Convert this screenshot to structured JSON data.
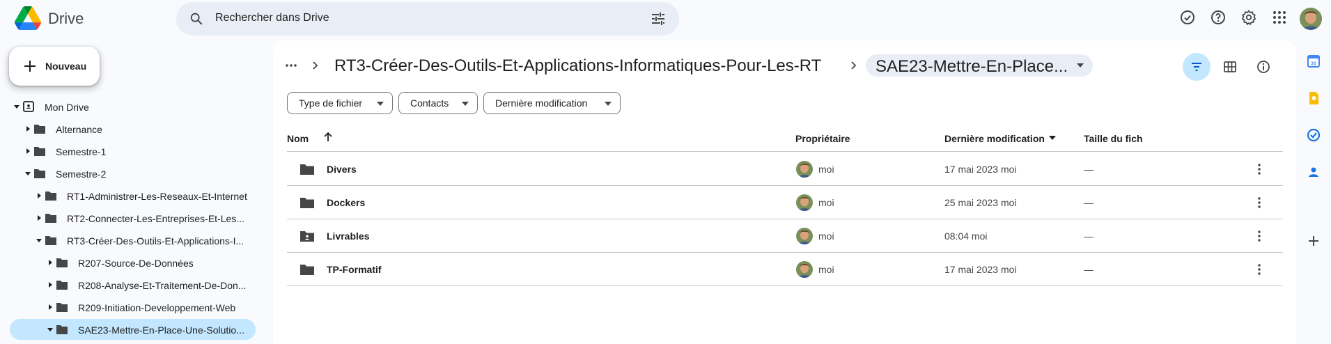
{
  "app": {
    "name": "Drive"
  },
  "search": {
    "placeholder": "Rechercher dans Drive"
  },
  "new_button": {
    "label": "Nouveau"
  },
  "tree": [
    {
      "label": "Mon Drive",
      "level": 0,
      "expanded": true,
      "kind": "drive"
    },
    {
      "label": "Alternance",
      "level": 1,
      "expanded": false,
      "kind": "folder"
    },
    {
      "label": "Semestre-1",
      "level": 1,
      "expanded": false,
      "kind": "folder"
    },
    {
      "label": "Semestre-2",
      "level": 1,
      "expanded": true,
      "kind": "folder"
    },
    {
      "label": "RT1-Administrer-Les-Reseaux-Et-Internet",
      "level": 2,
      "expanded": false,
      "kind": "folder"
    },
    {
      "label": "RT2-Connecter-Les-Entreprises-Et-Les...",
      "level": 2,
      "expanded": false,
      "kind": "folder"
    },
    {
      "label": "RT3-Créer-Des-Outils-Et-Applications-I...",
      "level": 2,
      "expanded": true,
      "kind": "folder"
    },
    {
      "label": "R207-Source-De-Données",
      "level": 3,
      "expanded": false,
      "kind": "folder"
    },
    {
      "label": "R208-Analyse-Et-Traitement-De-Don...",
      "level": 3,
      "expanded": false,
      "kind": "folder"
    },
    {
      "label": "R209-Initiation-Developpement-Web",
      "level": 3,
      "expanded": false,
      "kind": "folder"
    },
    {
      "label": "SAE23-Mettre-En-Place-Une-Solutio...",
      "level": 3,
      "expanded": true,
      "kind": "folder",
      "selected": true
    }
  ],
  "breadcrumb": {
    "parent": "RT3-Créer-Des-Outils-Et-Applications-Informatiques-Pour-Les-RT",
    "current": "SAE23-Mettre-En-Place..."
  },
  "filters": [
    {
      "label": "Type de fichier"
    },
    {
      "label": "Contacts"
    },
    {
      "label": "Dernière modification"
    }
  ],
  "table": {
    "columns": {
      "name": "Nom",
      "owner": "Propriétaire",
      "modified": "Dernière modification",
      "size": "Taille du fich"
    },
    "rows": [
      {
        "name": "Divers",
        "icon": "folder-icon",
        "owner": "moi",
        "modified": "17 mai 2023 moi",
        "size": "—"
      },
      {
        "name": "Dockers",
        "icon": "folder-icon",
        "owner": "moi",
        "modified": "25 mai 2023 moi",
        "size": "—"
      },
      {
        "name": "Livrables",
        "icon": "shared-folder-icon",
        "owner": "moi",
        "modified": "08:04 moi",
        "size": "—"
      },
      {
        "name": "TP-Formatif",
        "icon": "folder-icon",
        "owner": "moi",
        "modified": "17 mai 2023 moi",
        "size": "—"
      }
    ]
  },
  "colors": {
    "accent": "#0b57d0",
    "selected_bg": "#c2e7ff",
    "search_bg": "#e9eef6",
    "page_bg": "#f8fafd"
  }
}
